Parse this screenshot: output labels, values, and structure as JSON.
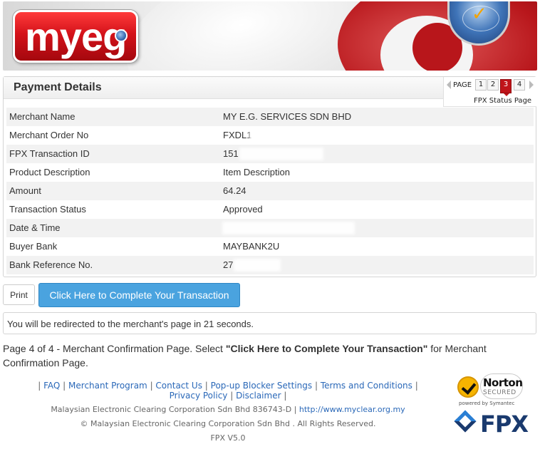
{
  "header": {
    "logo_text": "myeg"
  },
  "panel": {
    "title": "Payment Details",
    "pager": {
      "label": "PAGE",
      "pages": [
        "1",
        "2",
        "3",
        "4"
      ],
      "current_page": "3",
      "status_label": "FPX Status Page"
    },
    "rows": [
      {
        "label": "Merchant Name",
        "value": "MY E.G. SERVICES SDN BHD"
      },
      {
        "label": "Merchant Order No",
        "value": "FXDL1"
      },
      {
        "label": "FPX Transaction ID",
        "value": "151"
      },
      {
        "label": "Product Description",
        "value": "Item Description"
      },
      {
        "label": "Amount",
        "value": "64.24"
      },
      {
        "label": "Transaction Status",
        "value": "Approved"
      },
      {
        "label": "Date & Time",
        "value": ""
      },
      {
        "label": "Buyer Bank",
        "value": "MAYBANK2U"
      },
      {
        "label": "Bank Reference No.",
        "value": "27"
      }
    ]
  },
  "actions": {
    "print_label": "Print",
    "complete_label": "Click Here to Complete Your Transaction"
  },
  "redirect": {
    "message": "You will be redirected to the merchant's page in 21 seconds."
  },
  "info": {
    "prefix": "Page 4 of 4 - Merchant Confirmation Page. Select ",
    "emphasis": "\"Click Here to Complete Your Transaction\"",
    "suffix": " for Merchant Confirmation Page."
  },
  "footer": {
    "links": [
      "FAQ",
      "Merchant Program",
      "Contact Us",
      "Pop-up Blocker Settings",
      "Terms and Conditions",
      "Privacy Policy",
      "Disclaimer"
    ],
    "company_line": "Malaysian Electronic Clearing Corporation Sdn Bhd 836743-D |",
    "company_url": "http://www.myclear.org.my",
    "copyright": "© Malaysian Electronic Clearing Corporation Sdn Bhd . All Rights Reserved.",
    "version": "FPX V5.0"
  },
  "badges": {
    "norton_name": "Norton",
    "norton_secured": "SECURED",
    "norton_powered": "powered by Symantec",
    "fpx_text": "FPX"
  },
  "colors": {
    "brand_red": "#c0141a",
    "button_blue": "#4aa3df",
    "link_blue": "#2a68b8"
  }
}
